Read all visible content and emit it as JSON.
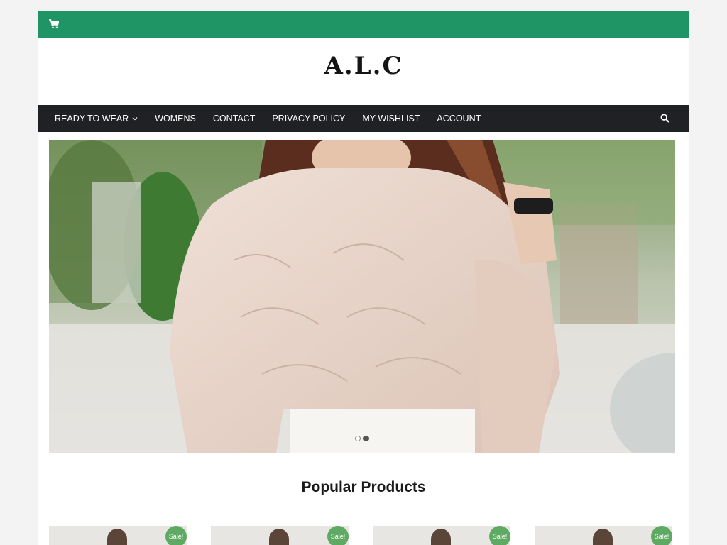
{
  "topbar": {
    "cart_icon": "shopping-cart-icon",
    "color": "#1f9565"
  },
  "header": {
    "logo": "A.L.C"
  },
  "nav": {
    "items": [
      {
        "label": "READY TO WEAR",
        "has_dropdown": true
      },
      {
        "label": "WOMENS"
      },
      {
        "label": "CONTACT"
      },
      {
        "label": "PRIVACY POLICY"
      },
      {
        "label": "MY WISHLIST"
      },
      {
        "label": "ACCOUNT"
      }
    ],
    "search_icon": "search-icon"
  },
  "slider": {
    "slide_count": 2,
    "active_index": 1
  },
  "popular": {
    "title": "Popular Products",
    "badges": [
      "Sale!",
      "Sale!",
      "Sale!",
      "Sale!"
    ]
  },
  "colors": {
    "accent": "#1f9565",
    "nav_bg": "#202124",
    "sale_badge": "#5faa63"
  }
}
